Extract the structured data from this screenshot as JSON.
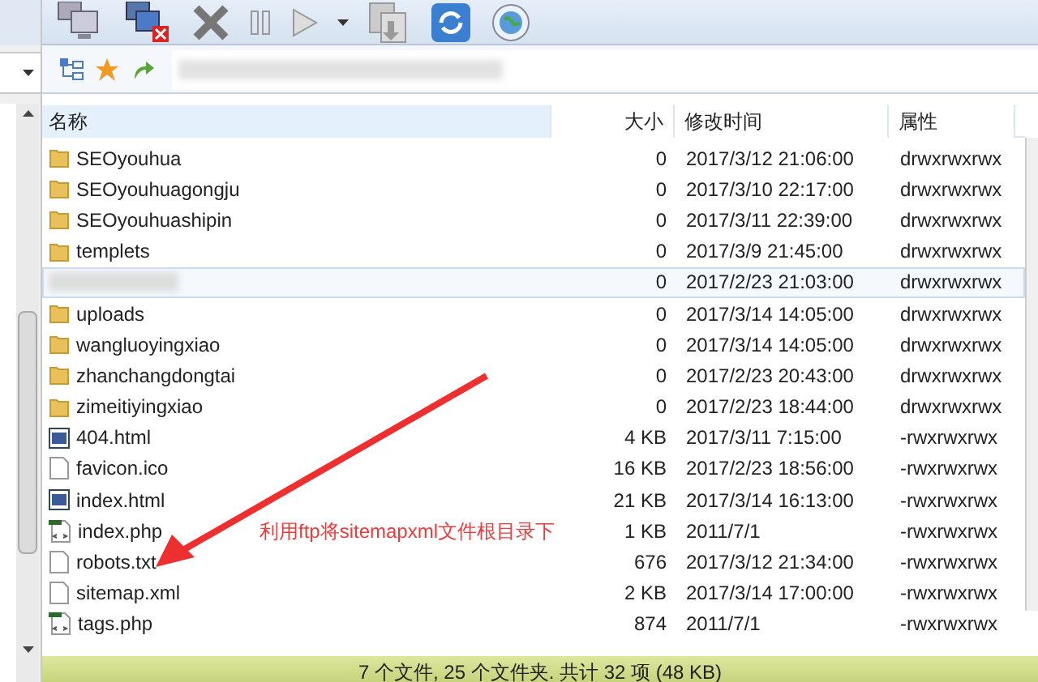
{
  "file_list": {
    "columns": [
      "名称",
      "大小",
      "修改时间",
      "属性"
    ],
    "rows": [
      {
        "kind": "folder",
        "name": "SEOyouhua",
        "size": "0",
        "modified": "2017/3/12 21:06:00",
        "attributes": "drwxrwxrwx",
        "selected": false
      },
      {
        "kind": "folder",
        "name": "SEOyouhuagongju",
        "size": "0",
        "modified": "2017/3/10 22:17:00",
        "attributes": "drwxrwxrwx",
        "selected": false
      },
      {
        "kind": "folder",
        "name": "SEOyouhuashipin",
        "size": "0",
        "modified": "2017/3/11 22:39:00",
        "attributes": "drwxrwxrwx",
        "selected": false
      },
      {
        "kind": "folder",
        "name": "templets",
        "size": "0",
        "modified": "2017/3/9 21:45:00",
        "attributes": "drwxrwxrwx",
        "selected": false
      },
      {
        "kind": "hidden",
        "size": "0",
        "modified": "2017/2/23 21:03:00",
        "attributes": "drwxrwxrwx",
        "selected": true
      },
      {
        "kind": "folder",
        "name": "uploads",
        "size": "0",
        "modified": "2017/3/14 14:05:00",
        "attributes": "drwxrwxrwx",
        "selected": false
      },
      {
        "kind": "folder",
        "name": "wangluoyingxiao",
        "size": "0",
        "modified": "2017/3/14 14:05:00",
        "attributes": "drwxrwxrwx",
        "selected": false
      },
      {
        "kind": "folder",
        "name": "zhanchangdongtai",
        "size": "0",
        "modified": "2017/2/23 20:43:00",
        "attributes": "drwxrwxrwx",
        "selected": false
      },
      {
        "kind": "folder",
        "name": "zimeitiyingxiao",
        "size": "0",
        "modified": "2017/2/23 18:44:00",
        "attributes": "drwxrwxrwx",
        "selected": false
      },
      {
        "kind": "html",
        "name": "404.html",
        "size": "4 KB",
        "modified": "2017/3/11 7:15:00",
        "attributes": "-rwxrwxrwx",
        "selected": false
      },
      {
        "kind": "file",
        "name": "favicon.ico",
        "size": "16 KB",
        "modified": "2017/2/23 18:56:00",
        "attributes": "-rwxrwxrwx",
        "selected": false
      },
      {
        "kind": "html",
        "name": "index.html",
        "size": "21 KB",
        "modified": "2017/3/14 16:13:00",
        "attributes": "-rwxrwxrwx",
        "selected": false
      },
      {
        "kind": "php",
        "name": "index.php",
        "size": "1 KB",
        "modified": "2011/7/1",
        "attributes": "-rwxrwxrwx",
        "selected": false
      },
      {
        "kind": "file",
        "name": "robots.txt",
        "size": "676",
        "modified": "2017/3/12 21:34:00",
        "attributes": "-rwxrwxrwx",
        "selected": false
      },
      {
        "kind": "file",
        "name": "sitemap.xml",
        "size": "2 KB",
        "modified": "2017/3/14 17:00:00",
        "attributes": "-rwxrwxrwx",
        "selected": false
      },
      {
        "kind": "php",
        "name": "tags.php",
        "size": "874",
        "modified": "2011/7/1",
        "attributes": "-rwxrwxrwx",
        "selected": false
      }
    ]
  },
  "annotation": "利用ftp将sitemapxml文件根目录下",
  "status_bar": "7 个文件, 25 个文件夹. 共计 32 项 (48 KB)"
}
